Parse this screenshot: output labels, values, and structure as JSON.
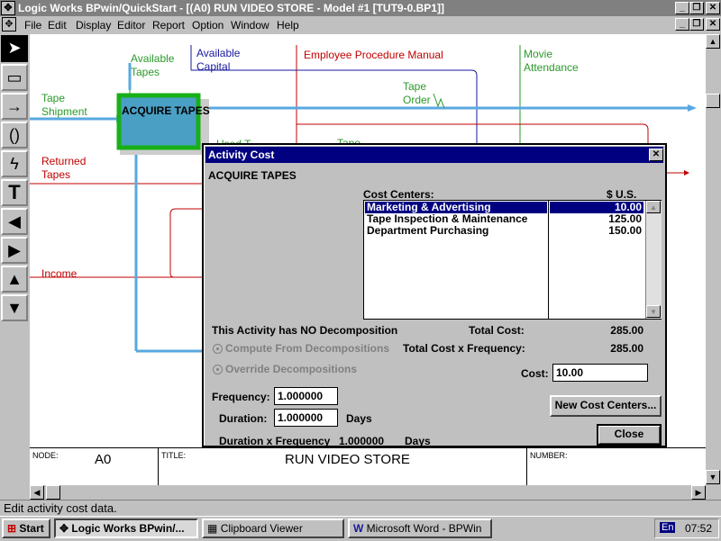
{
  "app": {
    "title": "Logic Works BPwin/QuickStart - [(A0) RUN VIDEO STORE - Model #1  [TUT9-0.BP1]]"
  },
  "menu": [
    "File",
    "Edit",
    "Display",
    "Editor",
    "Report",
    "Option",
    "Window",
    "Help"
  ],
  "diagram": {
    "activity_box": "ACQUIRE TAPES",
    "labels": {
      "available_tapes": "Available Tapes",
      "available_capital": "Available Capital",
      "employee_manual": "Employee Procedure Manual",
      "movie_attendance": "Movie Attendance",
      "tape_shipment": "Tape Shipment",
      "tape_order": "Tape Order",
      "returned_tapes": "Returned Tapes",
      "income": "Income",
      "partial_1": "Used T",
      "partial_2": "Tape"
    },
    "node_strip": {
      "node_label": "NODE:",
      "node_value": "A0",
      "title_label": "TITLE:",
      "title_value": "RUN VIDEO STORE",
      "number_label": "NUMBER:"
    }
  },
  "dialog": {
    "title": "Activity Cost",
    "activity_name": "ACQUIRE TAPES",
    "cost_centers_header": "Cost Centers:",
    "currency_header": "$ U.S.",
    "cost_centers": [
      {
        "name": "Marketing & Advertising",
        "value": "10.00",
        "selected": true
      },
      {
        "name": "Tape Inspection & Maintenance",
        "value": "125.00",
        "selected": false
      },
      {
        "name": "Department Purchasing",
        "value": "150.00",
        "selected": false
      }
    ],
    "decomposition_note": "This Activity has NO Decomposition",
    "total_cost_label": "Total Cost:",
    "total_cost_value": "285.00",
    "total_freq_label": "Total Cost x Frequency:",
    "total_freq_value": "285.00",
    "radio_compute": "Compute From Decompositions",
    "radio_override": "Override Decompositions",
    "cost_label": "Cost:",
    "cost_value": "10.00",
    "frequency_label": "Frequency:",
    "frequency_value": "1.000000",
    "duration_label": "Duration:",
    "duration_value": "1.000000",
    "duration_unit": "Days",
    "dxf_label": "Duration x Frequency",
    "dxf_value": "1.000000",
    "dxf_unit": "Days",
    "new_cost_centers_button": "New Cost Centers...",
    "close_button": "Close"
  },
  "status": {
    "text": "Edit activity cost data."
  },
  "taskbar": {
    "start": "Start",
    "tasks": [
      "Logic Works BPwin/...",
      "Clipboard Viewer",
      "Microsoft Word - BPWin"
    ],
    "lang": "En",
    "clock": "07:52"
  },
  "colors": {
    "title_active": "#000080",
    "title_inactive": "#808080",
    "activity_fill": "#4a9fc4",
    "activity_border": "#18b018",
    "arrow_green": "#2a9a2a",
    "arrow_blue": "#1a1aa0",
    "arrow_red": "#c00000",
    "arrow_cyan": "#5aa8e0"
  },
  "icons": [
    "app-icon",
    "pointer-tool-icon",
    "box-tool-icon",
    "arrow-tool-icon",
    "tunnel-tool-icon",
    "squiggle-tool-icon",
    "text-tool-icon",
    "left-triangle-icon",
    "right-triangle-icon",
    "up-triangle-icon",
    "down-triangle-icon"
  ]
}
